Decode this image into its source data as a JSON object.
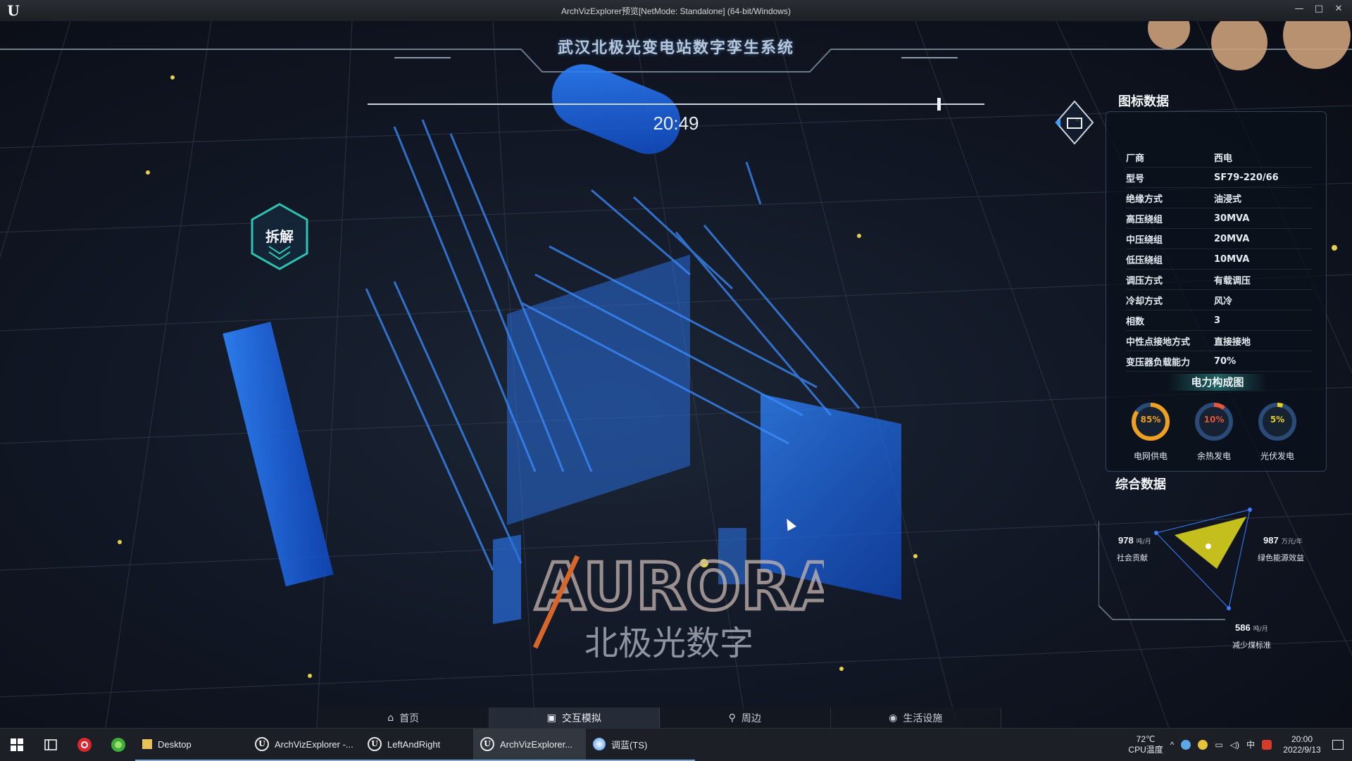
{
  "window": {
    "title": "ArchVizExplorer预览[NetMode: Standalone] (64-bit/Windows)",
    "logo": "U",
    "minimize": "—",
    "maximize": "□",
    "close": "✕"
  },
  "scene": {
    "title": "武汉北极光变电站数字孪生系统",
    "time": "20:49",
    "disassemble_label": "拆解",
    "watermark_main": "AURORA",
    "watermark_sub": "北极光数字",
    "colors": {
      "model_blue": "#1e6dff",
      "accent_teal": "#2fc3b2",
      "gold": "#e6b800"
    }
  },
  "icon_panel": {
    "title": "图标数据",
    "specs": [
      {
        "key": "厂商",
        "value": "西电"
      },
      {
        "key": "型号",
        "value": "SF79-220/66"
      },
      {
        "key": "绝缘方式",
        "value": "油浸式"
      },
      {
        "key": "高压绕组",
        "value": "30MVA"
      },
      {
        "key": "中压绕组",
        "value": "20MVA"
      },
      {
        "key": "低压绕组",
        "value": "10MVA"
      },
      {
        "key": "调压方式",
        "value": "有载调压"
      },
      {
        "key": "冷却方式",
        "value": "风冷"
      },
      {
        "key": "相数",
        "value": "3"
      },
      {
        "key": "中性点接地方式",
        "value": "直接接地"
      },
      {
        "key": "变压器负载能力",
        "value": "70%"
      }
    ],
    "power_title": "电力构成图",
    "gauges": [
      {
        "label": "电网供电",
        "pct_text": "85%",
        "value": 0.85,
        "color": "#f0a020"
      },
      {
        "label": "余热发电",
        "pct_text": "10%",
        "value": 0.1,
        "color": "#e8563a"
      },
      {
        "label": "光伏发电",
        "pct_text": "5%",
        "value": 0.05,
        "color": "#e6d020"
      }
    ]
  },
  "summary_panel": {
    "title": "综合数据",
    "items": [
      {
        "value": "978",
        "unit": "吨/月",
        "label": "社会贡献"
      },
      {
        "value": "987",
        "unit": "万元/年",
        "label": "绿色能源效益"
      },
      {
        "value": "586",
        "unit": "吨/月",
        "label": "减少煤标准"
      }
    ]
  },
  "bottom_nav": [
    {
      "label": "首页",
      "icon": "home-icon",
      "glyph": "⌂"
    },
    {
      "label": "交互模拟",
      "icon": "image-icon",
      "glyph": "▣"
    },
    {
      "label": "周边",
      "icon": "location-pin-icon",
      "glyph": "⚲"
    },
    {
      "label": "生活设施",
      "icon": "target-icon",
      "glyph": "◉"
    }
  ],
  "taskbar": {
    "apps": [
      {
        "label": "Desktop",
        "icon": "folder-icon"
      },
      {
        "label": "ArchVizExplorer -...",
        "icon": "unreal-icon"
      },
      {
        "label": "LeftAndRight",
        "icon": "unreal-icon"
      },
      {
        "label": "ArchVizExplorer...",
        "icon": "unreal-icon"
      },
      {
        "label": "调蓝(TS)",
        "icon": "app-icon"
      }
    ],
    "temp": "72℃",
    "cpu_label": "CPU温度",
    "ime": "中",
    "time": "20:00",
    "date": "2022/9/13"
  }
}
